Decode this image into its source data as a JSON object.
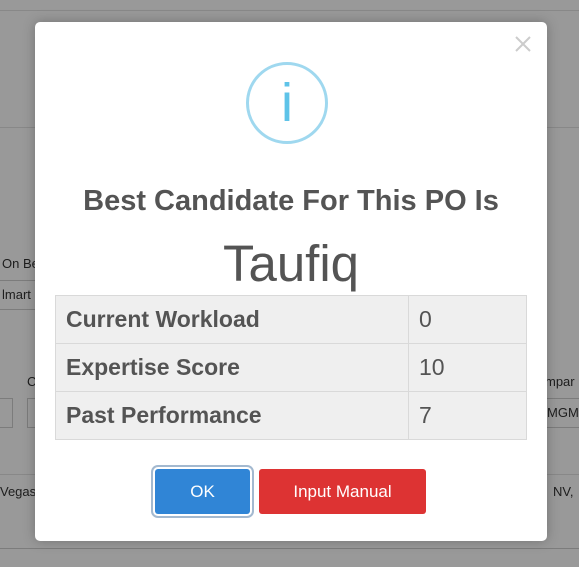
{
  "background": {
    "fragments": [
      "On Be",
      "lmart",
      "C",
      "mpar",
      "MGM S",
      "Vegas,",
      "NV,"
    ]
  },
  "modal": {
    "close_glyph": "×",
    "info_glyph": "i",
    "title": "Best Candidate For This PO Is",
    "candidate": "Taufiq",
    "stats": [
      {
        "label": "Current Workload",
        "value": "0"
      },
      {
        "label": "Expertise Score",
        "value": "10"
      },
      {
        "label": "Past Performance",
        "value": "7"
      }
    ],
    "ok_label": "OK",
    "manual_label": "Input Manual"
  },
  "colors": {
    "confirm": "#3085d6",
    "cancel": "#dd3333",
    "info": "#5ec3e8"
  }
}
